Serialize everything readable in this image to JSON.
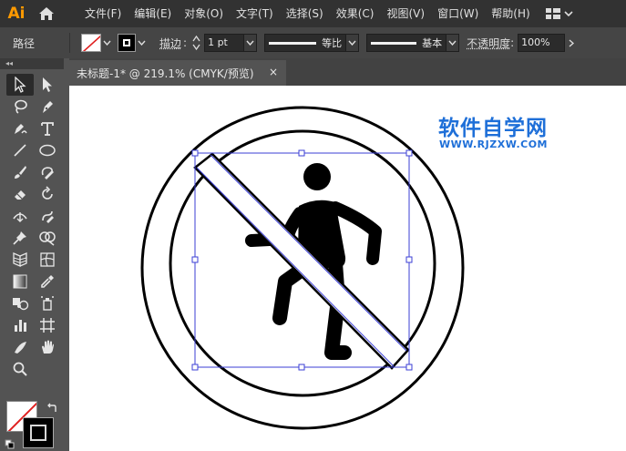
{
  "app": {
    "logo_text": "Ai"
  },
  "menu": {
    "items": [
      "文件(F)",
      "编辑(E)",
      "对象(O)",
      "文字(T)",
      "选择(S)",
      "效果(C)",
      "视图(V)",
      "窗口(W)",
      "帮助(H)"
    ]
  },
  "control": {
    "selection_type": "路径",
    "stroke_label": "描边",
    "stroke_weight": "1 pt",
    "profile_label": "等比",
    "brush_label": "基本",
    "opacity_label": "不透明度",
    "opacity_value": "100%"
  },
  "document": {
    "tab_title": "未标题-1* @ 219.1% (CMYK/预览)",
    "close_symbol": "×"
  },
  "toolbar": {
    "collapse_symbol": "◂◂",
    "tools": [
      "selection-tool",
      "direct-selection-tool",
      "lasso-tool",
      "pen-tool",
      "curvature-tool",
      "type-tool",
      "line-tool",
      "ellipse-tool",
      "paintbrush-tool",
      "shaper-tool",
      "eraser-tool",
      "rotate-tool",
      "width-tool",
      "warp-tool",
      "puppet-warp-tool",
      "shape-builder-tool",
      "perspective-grid-tool",
      "mesh-tool",
      "gradient-tool",
      "eyedropper-tool",
      "blend-tool",
      "symbol-sprayer-tool",
      "column-graph-tool",
      "artboard-tool",
      "slice-tool",
      "hand-tool",
      "zoom-tool"
    ]
  },
  "watermark": {
    "title": "软件自学网",
    "url": "WWW.RJZXW.COM",
    "color": "#1e6fd8"
  },
  "colors": {
    "selection": "#3b3fd6",
    "menubar_bg": "#323232",
    "canvas_bg": "#ffffff"
  }
}
